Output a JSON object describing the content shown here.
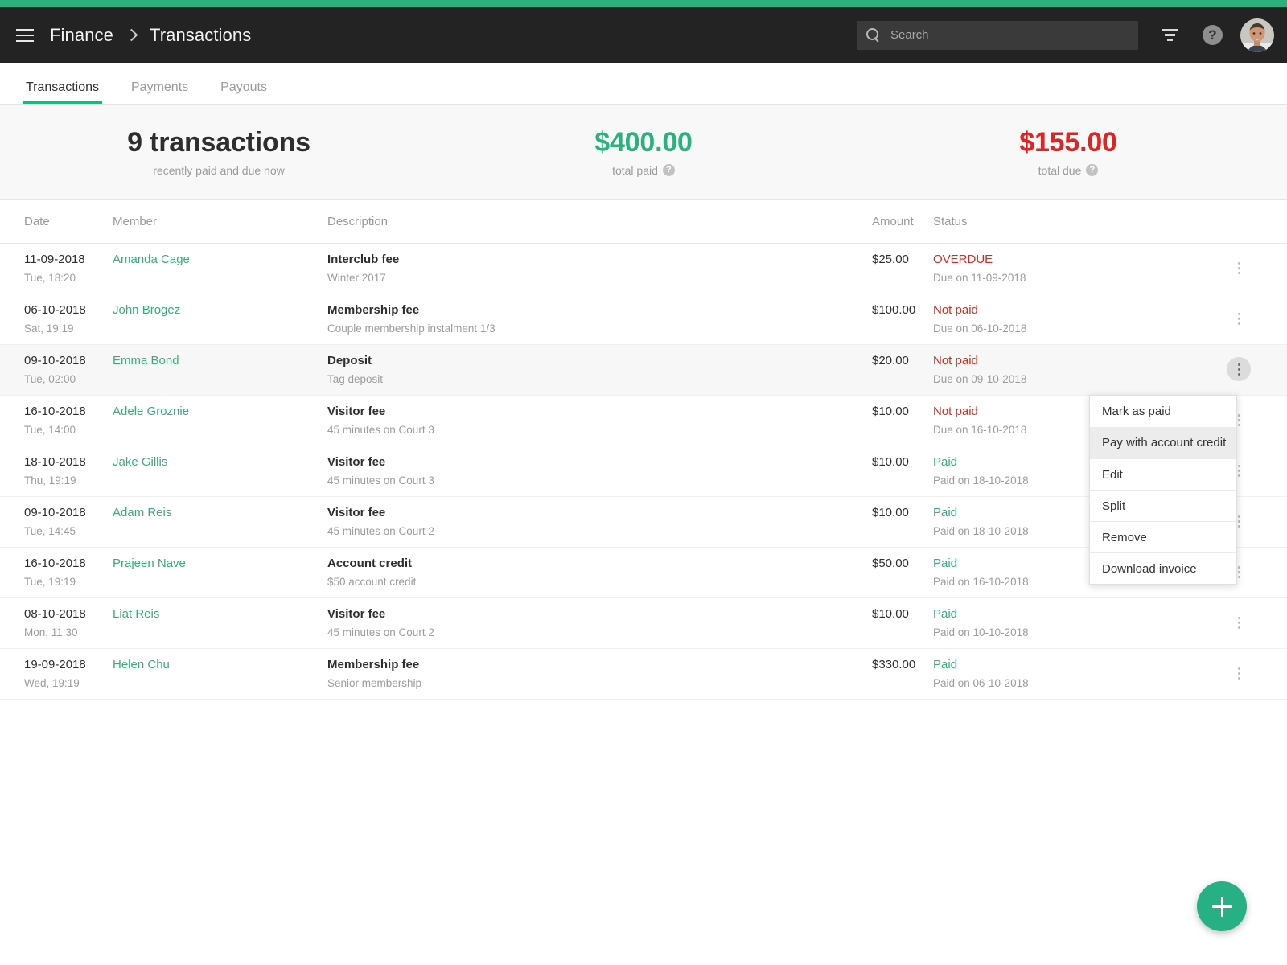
{
  "theme": {
    "accent": "#2bb07e",
    "green": "#3aab76",
    "red": "#d52b1e",
    "header_bg": "#232323"
  },
  "header": {
    "menu_icon": "hamburger-icon",
    "breadcrumb": {
      "root": "Finance",
      "current": "Transactions"
    },
    "search": {
      "placeholder": "Search",
      "value": "",
      "icon": "search-icon"
    },
    "filter_icon": "filter-icon",
    "help_icon": "help-icon",
    "help_label": "?",
    "avatar": "user-avatar"
  },
  "tabs": [
    {
      "label": "Transactions",
      "active": true
    },
    {
      "label": "Payments",
      "active": false
    },
    {
      "label": "Payouts",
      "active": false
    }
  ],
  "summary": {
    "count": {
      "value": "9 transactions",
      "sub": "recently paid and due now"
    },
    "paid": {
      "value": "$400.00",
      "sub": "total paid",
      "help": "?"
    },
    "due": {
      "value": "$155.00",
      "sub": "total due",
      "help": "?"
    }
  },
  "table": {
    "columns": [
      "Date",
      "Member",
      "Description",
      "Amount",
      "Status"
    ],
    "rows": [
      {
        "date": "11-09-2018",
        "time": "Tue, 18:20",
        "member": "Amanda Cage",
        "desc": "Interclub fee",
        "desc_sub": "Winter 2017",
        "amount": "$25.00",
        "status": "OVERDUE",
        "status_sub": "Due on 11-09-2018",
        "status_kind": "red",
        "active": false
      },
      {
        "date": "06-10-2018",
        "time": "Sat, 19:19",
        "member": "John Brogez",
        "desc": "Membership fee",
        "desc_sub": "Couple membership instalment 1/3",
        "amount": "$100.00",
        "status": "Not paid",
        "status_sub": "Due on 06-10-2018",
        "status_kind": "red",
        "active": false
      },
      {
        "date": "09-10-2018",
        "time": "Tue, 02:00",
        "member": "Emma Bond",
        "desc": "Deposit",
        "desc_sub": "Tag deposit",
        "amount": "$20.00",
        "status": "Not paid",
        "status_sub": "Due on 09-10-2018",
        "status_kind": "red",
        "active": true
      },
      {
        "date": "16-10-2018",
        "time": "Tue, 14:00",
        "member": "Adele Groznie",
        "desc": "Visitor fee",
        "desc_sub": "45 minutes on Court 3",
        "amount": "$10.00",
        "status": "Not paid",
        "status_sub": "Due on 16-10-2018",
        "status_kind": "red",
        "active": false
      },
      {
        "date": "18-10-2018",
        "time": "Thu, 19:19",
        "member": "Jake Gillis",
        "desc": "Visitor fee",
        "desc_sub": "45 minutes on Court 3",
        "amount": "$10.00",
        "status": "Paid",
        "status_sub": "Paid on 18-10-2018",
        "status_kind": "paid",
        "active": false
      },
      {
        "date": "09-10-2018",
        "time": "Tue, 14:45",
        "member": "Adam Reis",
        "desc": "Visitor fee",
        "desc_sub": "45 minutes on Court 2",
        "amount": "$10.00",
        "status": "Paid",
        "status_sub": "Paid on 18-10-2018",
        "status_kind": "paid",
        "active": false
      },
      {
        "date": "16-10-2018",
        "time": "Tue, 19:19",
        "member": "Prajeen Nave",
        "desc": "Account credit",
        "desc_sub": "$50 account credit",
        "amount": "$50.00",
        "status": "Paid",
        "status_sub": "Paid on 16-10-2018",
        "status_kind": "paid",
        "active": false
      },
      {
        "date": "08-10-2018",
        "time": "Mon, 11:30",
        "member": "Liat Reis",
        "desc": "Visitor fee",
        "desc_sub": "45 minutes on Court 2",
        "amount": "$10.00",
        "status": "Paid",
        "status_sub": "Paid on 10-10-2018",
        "status_kind": "paid",
        "active": false
      },
      {
        "date": "19-09-2018",
        "time": "Wed, 19:19",
        "member": "Helen Chu",
        "desc": "Membership fee",
        "desc_sub": "Senior membership",
        "amount": "$330.00",
        "status": "Paid",
        "status_sub": "Paid on 06-10-2018",
        "status_kind": "paid",
        "active": false
      }
    ]
  },
  "dropdown": {
    "open": true,
    "items": [
      {
        "label": "Mark as paid",
        "hover": false,
        "divider": false
      },
      {
        "label": "Pay with account credit",
        "hover": true,
        "divider": false
      },
      {
        "label": "Edit",
        "hover": false,
        "divider": true
      },
      {
        "label": "Split",
        "hover": false,
        "divider": true
      },
      {
        "label": "Remove",
        "hover": false,
        "divider": true
      },
      {
        "label": "Download invoice",
        "hover": false,
        "divider": true
      }
    ]
  },
  "fab": {
    "label": "+",
    "icon": "plus-icon"
  }
}
